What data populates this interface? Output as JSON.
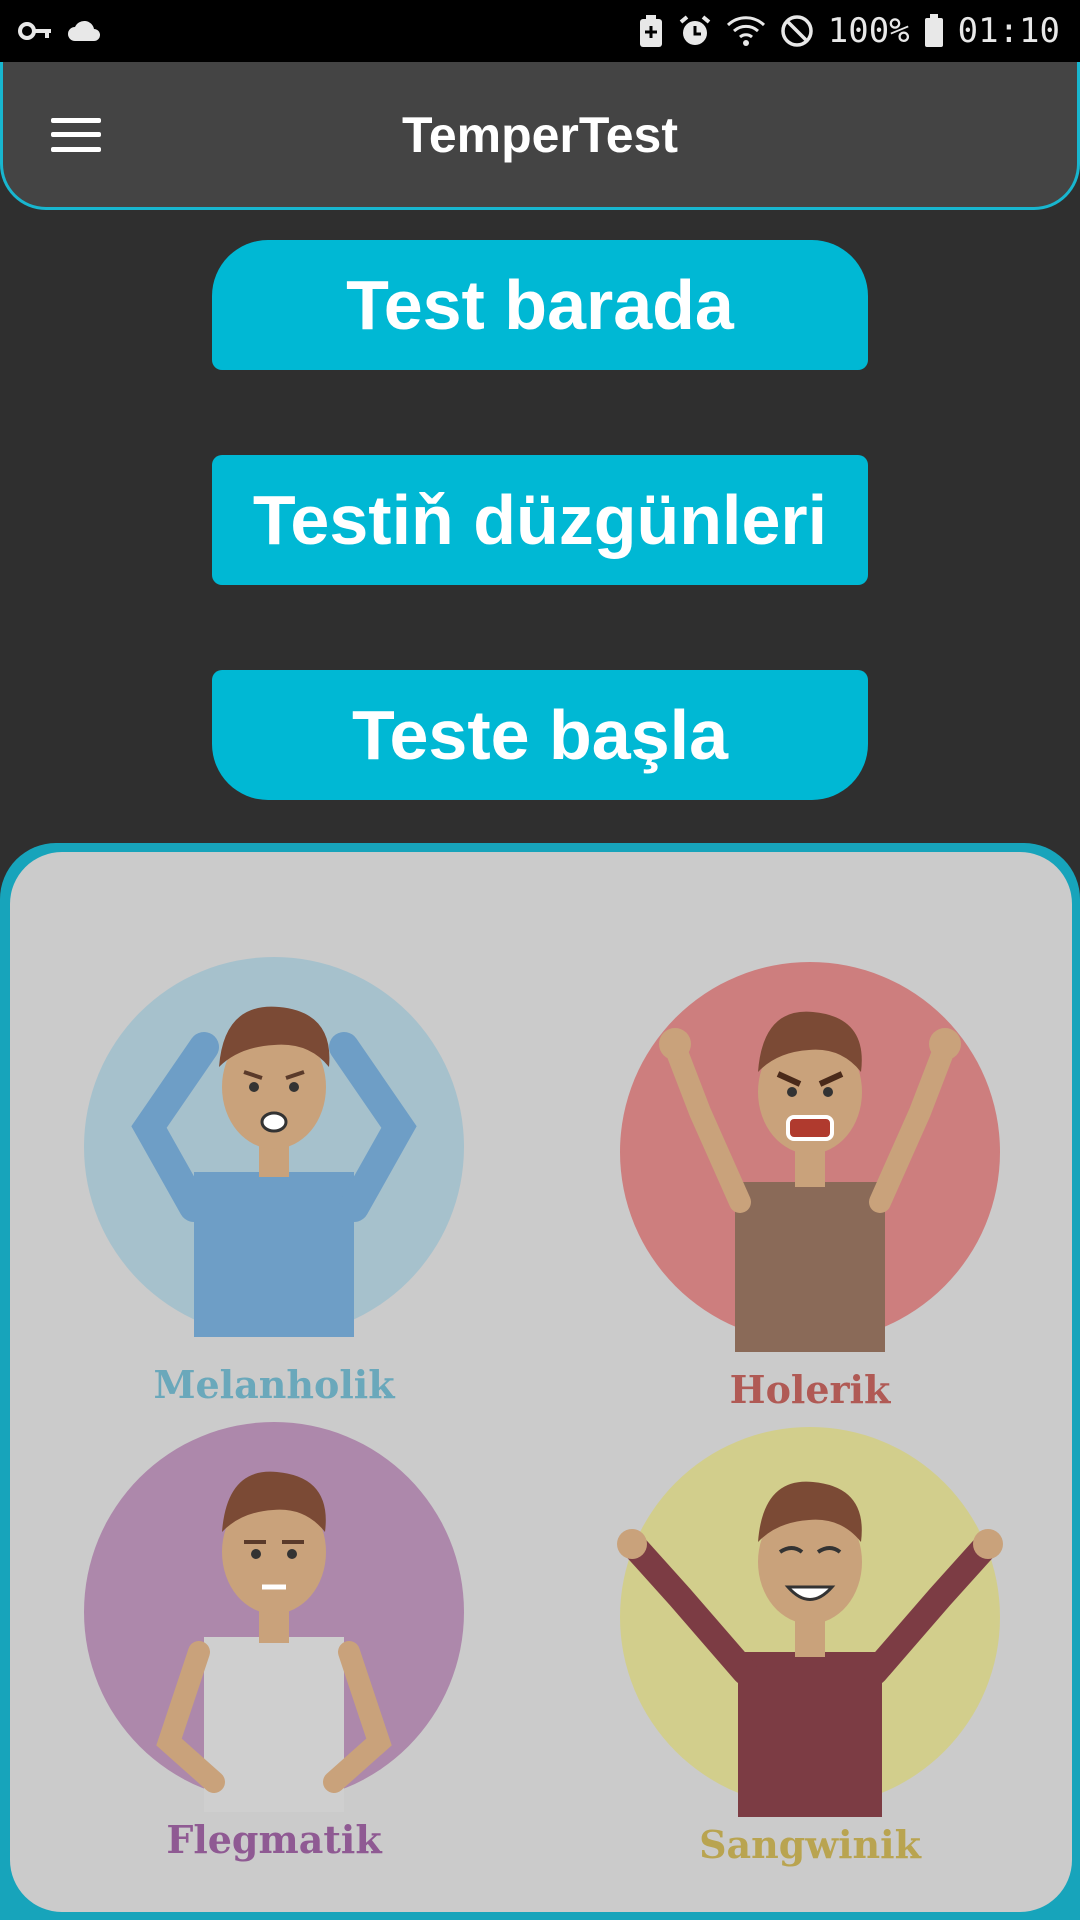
{
  "status_bar": {
    "battery_text": "100%",
    "time": "01:10",
    "icons": [
      "key-icon",
      "cloud-icon",
      "battery-saver-icon",
      "alarm-icon",
      "wifi-icon",
      "do-not-disturb-icon",
      "battery-icon"
    ]
  },
  "app_bar": {
    "title": "TemperTest",
    "menu_icon": "hamburger-menu-icon"
  },
  "buttons": {
    "about": "Test barada",
    "rules": "Testiň düzgünleri",
    "start": "Teste başla"
  },
  "temperaments": [
    {
      "label": "Melanholik",
      "color": "#7fb7c9",
      "label_color": "#6aa8bb"
    },
    {
      "label": "Holerik",
      "color": "#d27c7c",
      "label_color": "#b05a55"
    },
    {
      "label": "Flegmatik",
      "color": "#b38bb0",
      "label_color": "#8f5a93"
    },
    {
      "label": "Sangwinik",
      "color": "#d6d28a",
      "label_color": "#b9a450"
    }
  ],
  "colors": {
    "background": "#2f2f2f",
    "accent": "#00b8d4",
    "app_bar": "#444444",
    "panel": "#cbcbcb"
  }
}
